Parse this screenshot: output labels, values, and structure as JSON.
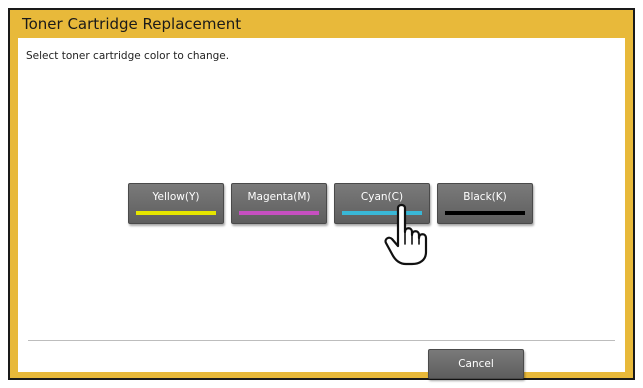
{
  "window": {
    "title": "Toner Cartridge Replacement"
  },
  "instruction": "Select toner cartridge color to change.",
  "color_buttons": [
    {
      "label": "Yellow(Y)",
      "bar_color": "#e6e600"
    },
    {
      "label": "Magenta(M)",
      "bar_color": "#c64fc0"
    },
    {
      "label": "Cyan(C)",
      "bar_color": "#39b7d6"
    },
    {
      "label": "Black(K)",
      "bar_color": "#000000"
    }
  ],
  "footer": {
    "cancel_label": "Cancel"
  },
  "cursor": {
    "icon": "pointing-hand-icon"
  },
  "colors": {
    "frame": "#e8b93a",
    "button": "#6b6b6b"
  }
}
